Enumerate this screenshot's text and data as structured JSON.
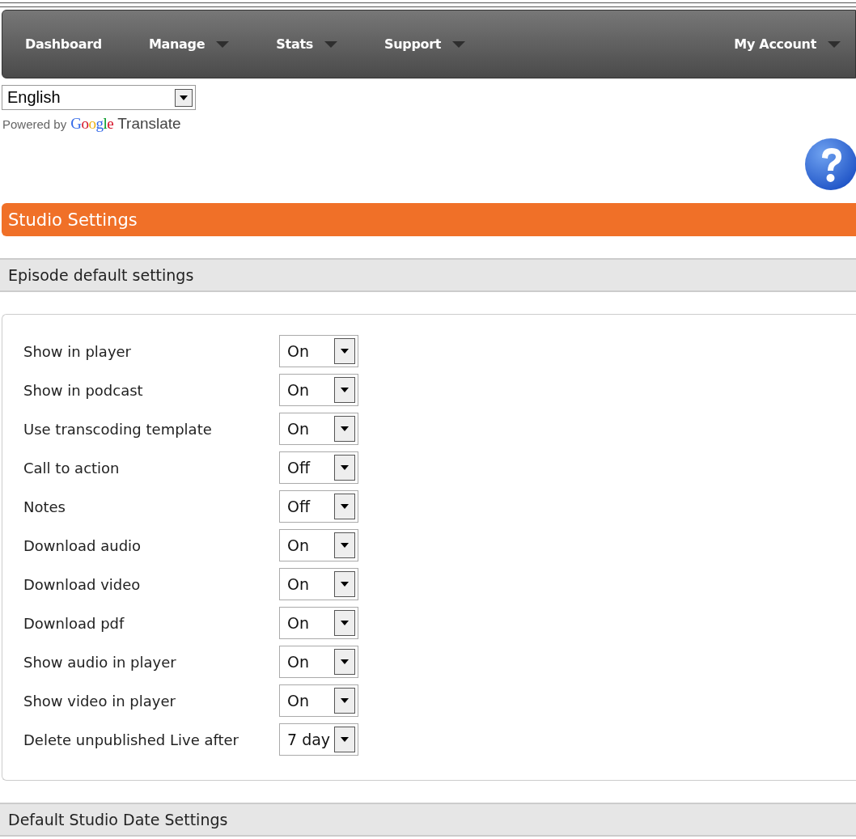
{
  "nav": {
    "items": [
      {
        "label": "Dashboard",
        "dropdown": false
      },
      {
        "label": "Manage",
        "dropdown": true
      },
      {
        "label": "Stats",
        "dropdown": true
      },
      {
        "label": "Support",
        "dropdown": true
      }
    ],
    "account": {
      "label": "My Account",
      "dropdown": true
    }
  },
  "language": {
    "value": "English"
  },
  "translate": {
    "prefix": "Powered by",
    "brand": "Google",
    "suffix": "Translate"
  },
  "page_title": "Studio Settings",
  "sections": [
    {
      "title": "Episode default settings",
      "settings": [
        {
          "label": "Show in player",
          "value": "On"
        },
        {
          "label": "Show in podcast",
          "value": "On"
        },
        {
          "label": "Use transcoding template",
          "value": "On"
        },
        {
          "label": "Call to action",
          "value": "Off"
        },
        {
          "label": "Notes",
          "value": "Off"
        },
        {
          "label": "Download audio",
          "value": "On"
        },
        {
          "label": "Download video",
          "value": "On"
        },
        {
          "label": "Download pdf",
          "value": "On"
        },
        {
          "label": "Show audio in player",
          "value": "On"
        },
        {
          "label": "Show video in player",
          "value": "On"
        },
        {
          "label": "Delete unpublished Live after",
          "value": "7 day"
        }
      ]
    },
    {
      "title": "Default Studio Date Settings"
    }
  ]
}
